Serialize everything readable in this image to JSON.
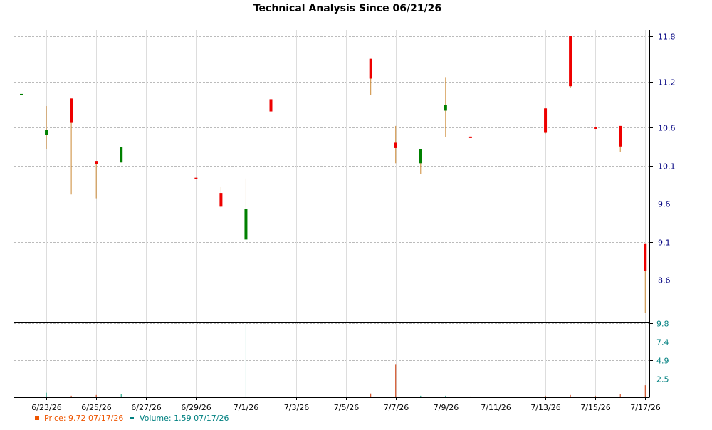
{
  "chart_data": {
    "type": "candlestick",
    "title": "Technical Analysis Since 06/21/26",
    "x": [
      "6/22/26",
      "6/23/26",
      "6/24/26",
      "6/25/26",
      "6/26/26",
      "6/27/26",
      "6/28/26",
      "6/29/26",
      "6/30/26",
      "7/1/26",
      "7/2/26",
      "7/3/26",
      "7/4/26",
      "7/5/26",
      "7/6/26",
      "7/7/26",
      "7/8/26",
      "7/9/26",
      "7/10/26",
      "7/11/26",
      "7/12/26",
      "7/13/26",
      "7/14/26",
      "7/15/26",
      "7/16/26",
      "7/17/26"
    ],
    "x_tick_labels": [
      "6/23/26",
      "6/25/26",
      "6/27/26",
      "6/29/26",
      "7/1/26",
      "7/3/26",
      "7/5/26",
      "7/7/26",
      "7/9/26",
      "7/11/26",
      "7/13/26",
      "7/15/26",
      "7/17/26"
    ],
    "price_axis": {
      "ticks": [
        11.8,
        11.2,
        10.6,
        10.1,
        9.6,
        9.1,
        8.6
      ],
      "ylim": [
        8.05,
        11.88
      ]
    },
    "volume_axis": {
      "ticks": [
        9.8,
        7.4,
        4.9,
        2.5
      ],
      "ylim": [
        0,
        10
      ]
    },
    "colors": {
      "up": "#008000",
      "down": "#ee0000",
      "wick": "#cc8833",
      "volume_up": "#009977",
      "volume_down": "#cc3300",
      "grid": "#bbbbbb",
      "axis_text": "#000080",
      "volume_axis_text": "#008080"
    },
    "series": [
      {
        "name": "Price",
        "values": [
          {
            "x": "6/22/26",
            "open": 11.04,
            "high": 11.04,
            "low": 11.04,
            "close": 11.04
          },
          {
            "x": "6/23/26",
            "open": 10.5,
            "high": 10.88,
            "low": 10.32,
            "close": 10.57
          },
          {
            "x": "6/24/26",
            "open": 10.98,
            "high": 10.98,
            "low": 9.72,
            "close": 10.66
          },
          {
            "x": "6/25/26",
            "open": 10.16,
            "high": 10.16,
            "low": 9.67,
            "close": 10.12
          },
          {
            "x": "6/26/26",
            "open": 10.14,
            "high": 10.34,
            "low": 10.14,
            "close": 10.34
          },
          {
            "x": "6/27/26",
            "open": null,
            "high": null,
            "low": null,
            "close": null
          },
          {
            "x": "6/28/26",
            "open": null,
            "high": null,
            "low": null,
            "close": null
          },
          {
            "x": "6/29/26",
            "open": 9.94,
            "high": 9.94,
            "low": 9.93,
            "close": 9.93
          },
          {
            "x": "6/30/26",
            "open": 9.74,
            "high": 9.82,
            "low": 9.55,
            "close": 9.56
          },
          {
            "x": "7/1/26",
            "open": 9.13,
            "high": 9.93,
            "low": 9.13,
            "close": 9.53
          },
          {
            "x": "7/2/26",
            "open": 10.97,
            "high": 11.02,
            "low": 10.08,
            "close": 10.81
          },
          {
            "x": "7/3/26",
            "open": null,
            "high": null,
            "low": null,
            "close": null
          },
          {
            "x": "7/4/26",
            "open": null,
            "high": null,
            "low": null,
            "close": null
          },
          {
            "x": "7/5/26",
            "open": null,
            "high": null,
            "low": null,
            "close": null
          },
          {
            "x": "7/6/26",
            "open": 11.5,
            "high": 11.5,
            "low": 11.03,
            "close": 11.24
          },
          {
            "x": "7/7/26",
            "open": 10.4,
            "high": 10.62,
            "low": 10.13,
            "close": 10.33
          },
          {
            "x": "7/8/26",
            "open": 10.13,
            "high": 10.32,
            "low": 9.99,
            "close": 10.32
          },
          {
            "x": "7/9/26",
            "open": 10.82,
            "high": 11.26,
            "low": 10.47,
            "close": 10.89
          },
          {
            "x": "7/10/26",
            "open": 10.48,
            "high": 10.48,
            "low": 10.47,
            "close": 10.47
          },
          {
            "x": "7/11/26",
            "open": null,
            "high": null,
            "low": null,
            "close": null
          },
          {
            "x": "7/12/26",
            "open": null,
            "high": null,
            "low": null,
            "close": null
          },
          {
            "x": "7/13/26",
            "open": 10.85,
            "high": 10.85,
            "low": 10.52,
            "close": 10.53
          },
          {
            "x": "7/14/26",
            "open": 11.8,
            "high": 11.8,
            "low": 11.12,
            "close": 11.14
          },
          {
            "x": "7/15/26",
            "open": 10.6,
            "high": 10.6,
            "low": 10.59,
            "close": 10.59
          },
          {
            "x": "7/16/26",
            "open": 10.62,
            "high": 10.62,
            "low": 10.28,
            "close": 10.35
          },
          {
            "x": "7/17/26",
            "open": 9.07,
            "high": 9.07,
            "low": 8.17,
            "close": 8.72
          }
        ]
      },
      {
        "name": "Volume",
        "values": [
          {
            "x": "6/22/26",
            "value": 0.0
          },
          {
            "x": "6/23/26",
            "value": 0.6
          },
          {
            "x": "6/24/26",
            "value": 0.2
          },
          {
            "x": "6/25/26",
            "value": 0.3
          },
          {
            "x": "6/26/26",
            "value": 0.4
          },
          {
            "x": "6/27/26",
            "value": null
          },
          {
            "x": "6/28/26",
            "value": null
          },
          {
            "x": "6/29/26",
            "value": 0.1
          },
          {
            "x": "6/30/26",
            "value": 0.1
          },
          {
            "x": "7/1/26",
            "value": 9.8
          },
          {
            "x": "7/2/26",
            "value": 5.0
          },
          {
            "x": "7/3/26",
            "value": null
          },
          {
            "x": "7/4/26",
            "value": null
          },
          {
            "x": "7/5/26",
            "value": null
          },
          {
            "x": "7/6/26",
            "value": 0.5
          },
          {
            "x": "7/7/26",
            "value": 4.4
          },
          {
            "x": "7/8/26",
            "value": 0.2
          },
          {
            "x": "7/9/26",
            "value": 0.2
          },
          {
            "x": "7/10/26",
            "value": 0.1
          },
          {
            "x": "7/11/26",
            "value": null
          },
          {
            "x": "7/12/26",
            "value": null
          },
          {
            "x": "7/13/26",
            "value": 0.2
          },
          {
            "x": "7/14/26",
            "value": 0.3
          },
          {
            "x": "7/15/26",
            "value": 0.2
          },
          {
            "x": "7/16/26",
            "value": 0.4
          },
          {
            "x": "7/17/26",
            "value": 1.59
          }
        ]
      }
    ],
    "legend": {
      "placement": "bottom-left",
      "price_text": "Price: 9.72  07/17/26",
      "volume_text": "Volume: 1.59  07/17/26"
    }
  }
}
